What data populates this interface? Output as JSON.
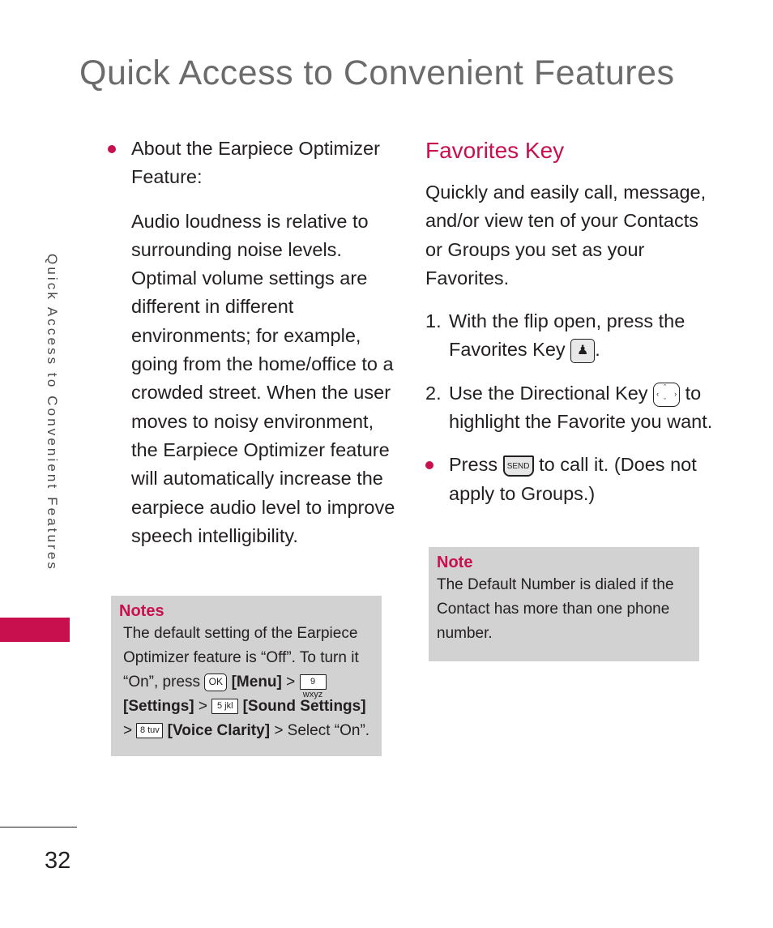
{
  "page": {
    "title": "Quick Access to Convenient Features",
    "side_tab_label": "Quick Access to Convenient Features",
    "page_number": "32",
    "accent_color": "#c8104e"
  },
  "left_column": {
    "bullet_heading": "About the Earpiece Optimizer Feature:",
    "paragraph": "Audio loudness is relative to surrounding noise levels. Optimal volume settings are different in different environments; for example, going from the home/office to a crowded street. When the user moves to noisy environment, the Earpiece Optimizer feature will automatically increase the earpiece audio level to improve speech intelligibility.",
    "notes": {
      "title": "Notes",
      "text_1": "The default setting of the Earpiece Optimizer feature is “Off”. To turn it “On”, press",
      "key_ok": "OK",
      "menu": "[Menu]",
      "sep": ">",
      "key_9": "9 wxyz",
      "settings": "[Settings]",
      "key_5": "5 jkl",
      "sound_settings": "[Sound Settings]",
      "key_8": "8 tuv",
      "voice_clarity": "[Voice Clarity]",
      "text_end": "> Select “On”."
    }
  },
  "right_column": {
    "heading": "Favorites Key",
    "intro": "Quickly and easily call, message, and/or view ten of your Contacts or Groups you set as your Favorites.",
    "steps": [
      {
        "num": "1.",
        "text": "With the flip open, press the Favorites Key",
        "key_icon": "favorites-key-icon",
        "after": "."
      },
      {
        "num": "2.",
        "text_before": "Use the Directional Key",
        "key_icon": "directional-key-icon",
        "text_after": "to highlight the Favorite you want."
      }
    ],
    "bullet": {
      "before": "Press",
      "key_label": "SEND",
      "after": "to call it. (Does not apply to Groups.)"
    },
    "note": {
      "title": "Note",
      "text": "The Default Number is dialed if the Contact has more than one phone number."
    }
  }
}
